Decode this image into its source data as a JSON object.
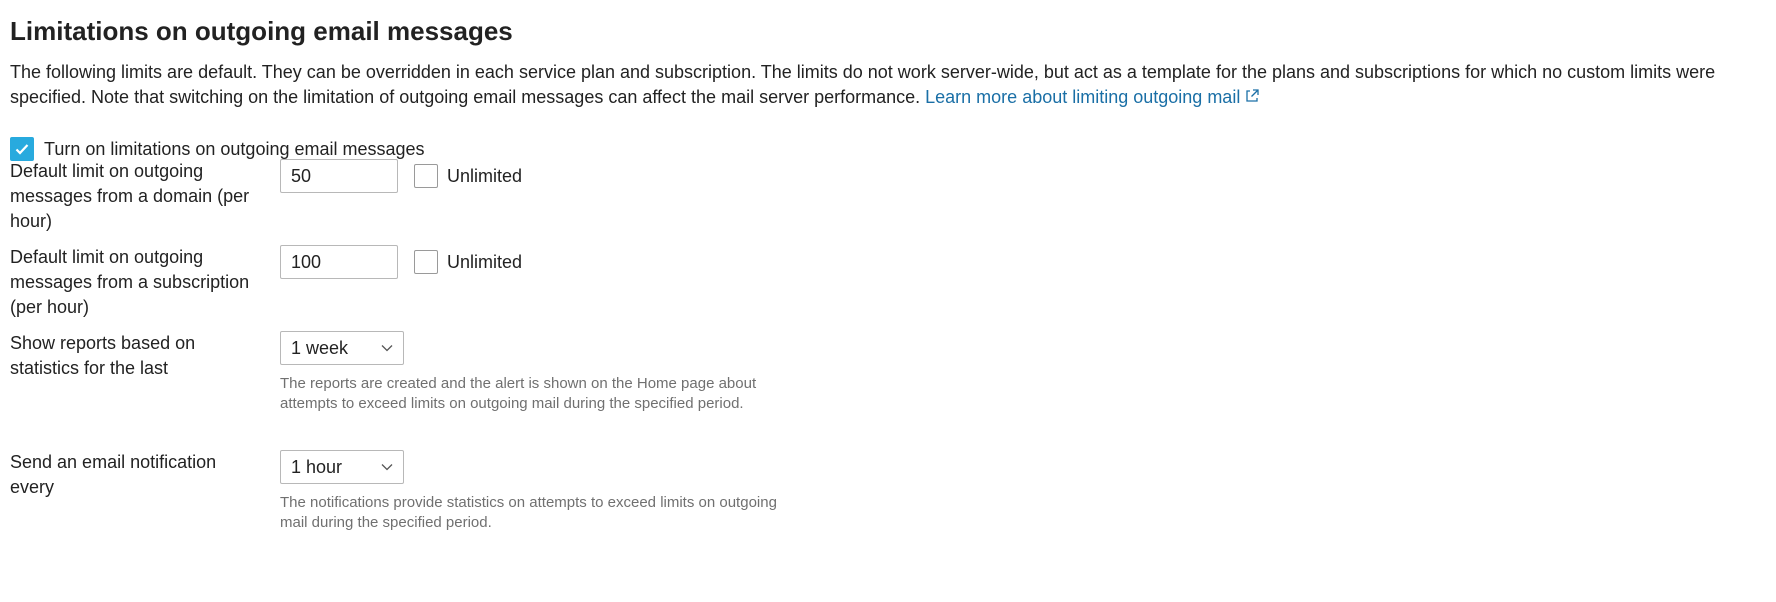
{
  "section": {
    "title": "Limitations on outgoing email messages",
    "intro_text": "The following limits are default. They can be overridden in each service plan and subscription. The limits do not work server-wide, but act as a template for the plans and subscriptions for which no custom limits were specified. Note that switching on the limitation of outgoing email messages can affect the mail server performance. ",
    "learn_more_link": "Learn more about limiting outgoing mail"
  },
  "toggle": {
    "label": "Turn on limitations on outgoing email messages",
    "checked": true
  },
  "domain_limit": {
    "label": "Default limit on outgoing messages from a domain (per hour)",
    "value": "50",
    "unlimited_label": "Unlimited",
    "unlimited_checked": false
  },
  "subscription_limit": {
    "label": "Default limit on outgoing messages from a subscription (per hour)",
    "value": "100",
    "unlimited_label": "Unlimited",
    "unlimited_checked": false
  },
  "report_period": {
    "label": "Show reports based on statistics for the last",
    "selected": "1 week",
    "hint": "The reports are created and the alert is shown on the Home page about attempts to exceed limits on outgoing mail during the specified period."
  },
  "notification_period": {
    "label": "Send an email notification every",
    "selected": "1 hour",
    "hint": "The notifications provide statistics on attempts to exceed limits on outgoing mail during the specified period."
  },
  "colors": {
    "accent": "#28aade",
    "link": "#1a6fa6",
    "hint_text": "#707070",
    "border": "#b8b8b8"
  },
  "icons": {
    "external_link": "external-link-icon",
    "checkmark": "checkmark-icon",
    "dropdown": "chevron-down-icon"
  }
}
